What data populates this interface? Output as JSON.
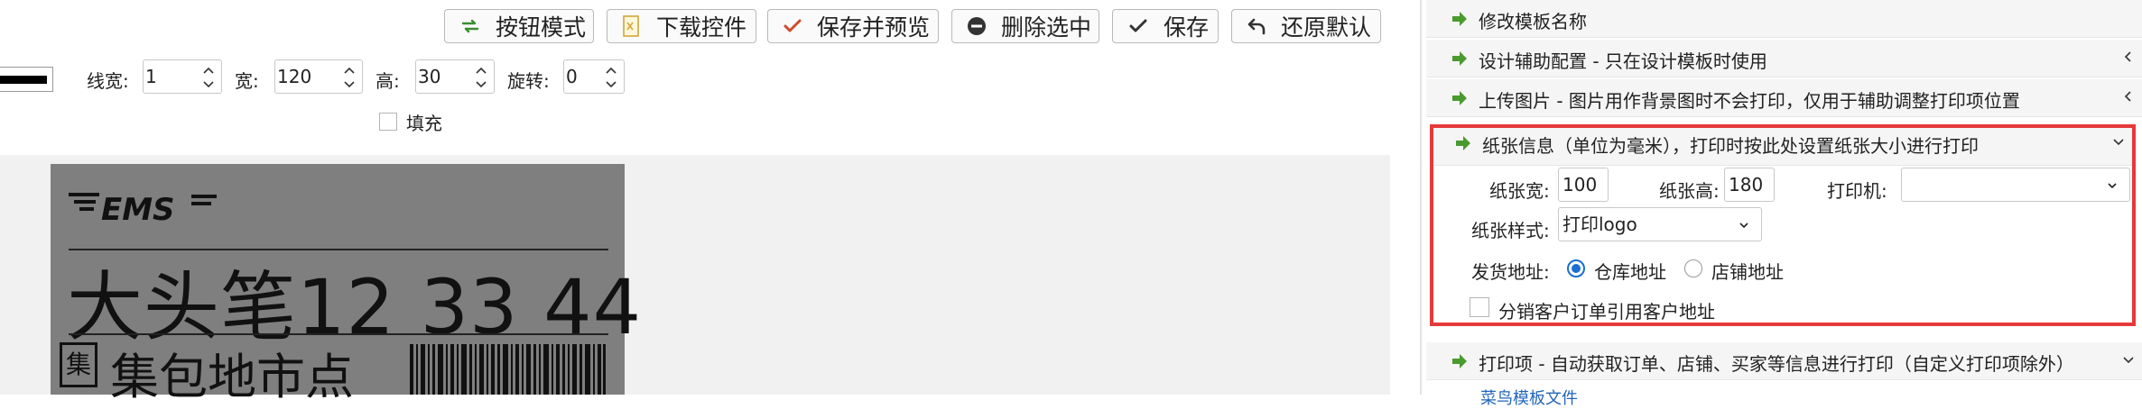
{
  "toolbar": {
    "buttons": [
      {
        "label": "按钮模式",
        "icon": "swap-arrows-icon"
      },
      {
        "label": "下载控件",
        "icon": "download-file-icon"
      },
      {
        "label": "保存并预览",
        "icon": "check-icon"
      },
      {
        "label": "删除选中",
        "icon": "minus-circle-icon"
      },
      {
        "label": "保存",
        "icon": "check-icon"
      },
      {
        "label": "还原默认",
        "icon": "undo-icon"
      }
    ]
  },
  "properties": {
    "line_width_label": "线宽:",
    "line_width_value": "1",
    "width_label": "宽:",
    "width_value": "120",
    "height_label": "高:",
    "height_value": "30",
    "rotate_label": "旋转:",
    "rotate_value": "0",
    "fill_label": "填充",
    "fill_checked": false,
    "line_color": "#000000"
  },
  "label_preview": {
    "logo_text": "EMS",
    "big_line": "大头笔12  33  44",
    "box_char": "集",
    "distribution_line": "集包地市点"
  },
  "right_panel": {
    "sections": [
      {
        "title": "修改模板名称",
        "expanded": false
      },
      {
        "title": "设计辅助配置 - 只在设计模板时使用",
        "expanded": false
      },
      {
        "title": "上传图片 - 图片用作背景图时不会打印，仅用于辅助调整打印项位置",
        "expanded": false
      },
      {
        "title": "纸张信息（单位为毫米），打印时按此处设置纸张大小进行打印",
        "expanded": true
      },
      {
        "title": "打印项 - 自动获取订单、店铺、买家等信息进行打印（自定义打印项除外）",
        "expanded": true
      }
    ],
    "paper": {
      "width_label": "纸张宽:",
      "width_value": "100",
      "height_label": "纸张高:",
      "height_value": "180",
      "printer_label": "打印机:",
      "printer_value": "",
      "style_label": "纸张样式:",
      "style_value": "打印logo",
      "ship_label": "发货地址:",
      "ship_options": [
        {
          "label": "仓库地址",
          "selected": true
        },
        {
          "label": "店铺地址",
          "selected": false
        }
      ],
      "reseller_label": "分销客户订单引用客户地址",
      "reseller_checked": false
    },
    "cut_text": "菜鸟模板文件"
  },
  "colors": {
    "accent_green": "#4a9a2f",
    "highlight_red": "#e5393a",
    "radio_blue": "#1a6fd1"
  }
}
